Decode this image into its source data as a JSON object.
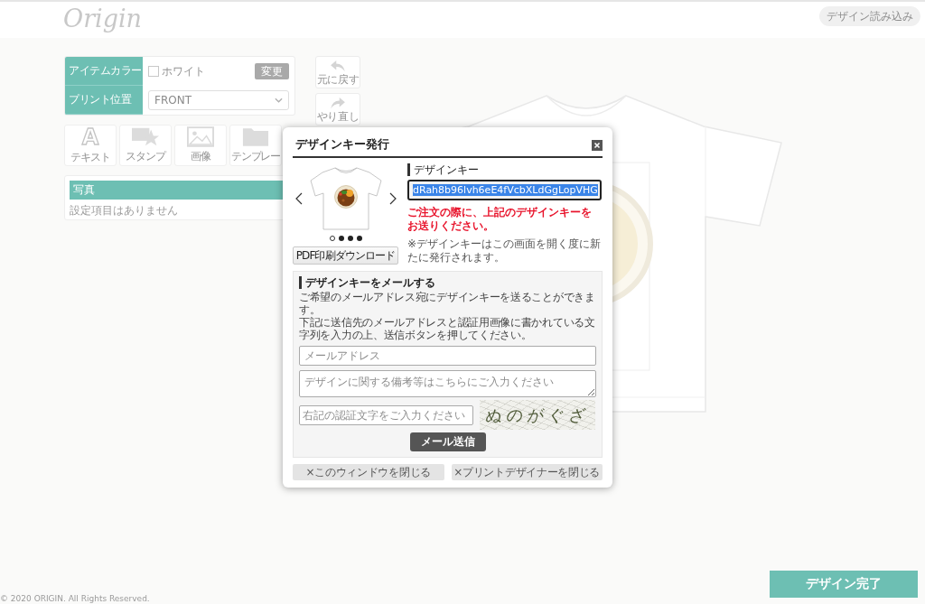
{
  "header": {
    "logo": "Origin",
    "load_button": "デザイン読み込み"
  },
  "settings": {
    "rows": [
      {
        "kind": "color",
        "label": "アイテムカラー",
        "value": "ホワイト",
        "button": "変更"
      },
      {
        "kind": "select",
        "label": "プリント位置",
        "value": "FRONT"
      }
    ]
  },
  "history_buttons": [
    {
      "kind": "undo",
      "label": "元に戻す"
    },
    {
      "kind": "redo",
      "label": "やり直し"
    }
  ],
  "tools": [
    {
      "kind": "text",
      "glyph": "A",
      "label": "テキスト"
    },
    {
      "kind": "stamp",
      "label": "スタンプ"
    },
    {
      "kind": "image",
      "label": "画像"
    },
    {
      "kind": "template",
      "label": "テンプレー"
    }
  ],
  "photo_panel": {
    "title": "写真",
    "message": "設定項目はありません"
  },
  "complete_button": "デザイン完了",
  "footer": "© 2020 ORIGIN. All Rights Reserved.",
  "dialog": {
    "title": "デザインキー発行",
    "preview": {
      "dots": [
        {
          "selected": true
        },
        {
          "selected": false
        },
        {
          "selected": false
        },
        {
          "selected": false
        }
      ]
    },
    "pdf_button": "PDF印刷ダウンロード",
    "key_label": "デザインキー",
    "key_field": {
      "value": "dRah8b96lvh6eE4fVcbXLdGgLopVHG",
      "selected": true
    },
    "notice": "ご注文の際に、上記のデザインキーをお送りください。",
    "note": "※デザインキーはこの画面を開く度に新たに発行されます。",
    "mail": {
      "title": "デザインキーをメールする",
      "description": [
        "ご希望のメールアドレス宛にデザインキーを送ることができます。",
        "下記に送信先のメールアドレスと認証用画像に書かれている文字列を入力の上、送信ボタンを押してください。"
      ],
      "email": {
        "placeholder": "メールアドレス"
      },
      "remarks": {
        "placeholder": "デザインに関する備考等はこちらにご入力ください"
      },
      "captcha_input": {
        "placeholder": "右記の認証文字をご入力ください"
      },
      "captcha_text": "ぬのがぐざ",
      "send_button": "メール送信"
    },
    "footer_buttons": [
      "×このウィンドウを閉じる",
      "×プリントデザイナーを閉じる"
    ]
  }
}
